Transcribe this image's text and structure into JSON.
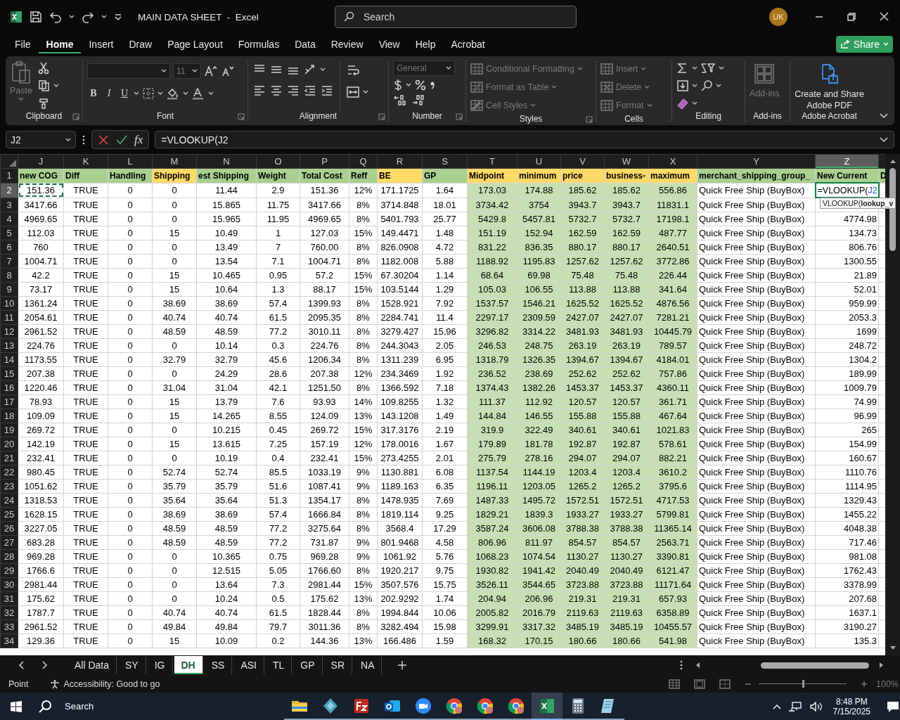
{
  "title_bar": {
    "title": "MAIN DATA SHEET  -  Excel",
    "search": {
      "placeholder": "Search"
    },
    "avatar": "UK"
  },
  "menu_tabs": [
    {
      "label": "File",
      "selected": false
    },
    {
      "label": "Home",
      "selected": true
    },
    {
      "label": "Insert",
      "selected": false
    },
    {
      "label": "Draw",
      "selected": false
    },
    {
      "label": "Page Layout",
      "selected": false
    },
    {
      "label": "Formulas",
      "selected": false
    },
    {
      "label": "Data",
      "selected": false
    },
    {
      "label": "Review",
      "selected": false
    },
    {
      "label": "View",
      "selected": false
    },
    {
      "label": "Help",
      "selected": false
    },
    {
      "label": "Acrobat",
      "selected": false
    }
  ],
  "share_button": "Share",
  "ribbon": {
    "clipboard": {
      "label": "Clipboard",
      "paste": {
        "label": "Paste",
        "disabled": true
      }
    },
    "font": {
      "label": "Font",
      "points": "11",
      "styles": [
        "B",
        "I",
        "U"
      ]
    },
    "alignment": {
      "label": "Alignment"
    },
    "number": {
      "label": "Number",
      "format": "General"
    },
    "styles": {
      "label": "Styles",
      "items": [
        {
          "label": "Conditional Formatting",
          "disabled": true
        },
        {
          "label": "Format as Table",
          "disabled": true
        },
        {
          "label": "Cell Styles",
          "disabled": true
        }
      ]
    },
    "cells": {
      "label": "Cells",
      "items": [
        {
          "label": "Insert",
          "disabled": true
        },
        {
          "label": "Delete",
          "disabled": true
        },
        {
          "label": "Format",
          "disabled": true
        }
      ]
    },
    "editing": {
      "label": "Editing"
    },
    "addins": {
      "label": "Add-ins",
      "button": {
        "label": "Add-ins",
        "disabled": true
      }
    },
    "acrobat": {
      "label": "Adobe Acrobat",
      "button": {
        "label": "Create and Share Adobe PDF",
        "disabled": false
      }
    }
  },
  "formula_bar": {
    "name_box": "J2",
    "fx": "fx",
    "formula": "=VLOOKUP(J2"
  },
  "sheet": {
    "header_row_number": "1",
    "columns": [
      {
        "letter": "J",
        "label": "new COG",
        "color": "#a9d08e",
        "kind": "number",
        "shaded": false,
        "selected": false
      },
      {
        "letter": "K",
        "label": "Diff",
        "color": "#a9d08e",
        "kind": "number",
        "shaded": false,
        "selected": false
      },
      {
        "letter": "L",
        "label": "Handling",
        "color": "#a9d08e",
        "kind": "number",
        "shaded": false,
        "selected": false
      },
      {
        "letter": "M",
        "label": "Shipping",
        "color": "#ffd966",
        "kind": "number",
        "shaded": false,
        "selected": false
      },
      {
        "letter": "N",
        "label": "est Shipping",
        "color": "#a9d08e",
        "kind": "number",
        "shaded": false,
        "selected": false
      },
      {
        "letter": "O",
        "label": "Weight",
        "color": "#a9d08e",
        "kind": "number",
        "shaded": false,
        "selected": false
      },
      {
        "letter": "P",
        "label": "Total Cost",
        "color": "#a9d08e",
        "kind": "number",
        "shaded": false,
        "selected": false
      },
      {
        "letter": "Q",
        "label": "Reff",
        "color": "#a9d08e",
        "kind": "number",
        "shaded": false,
        "selected": false
      },
      {
        "letter": "R",
        "label": "BE",
        "color": "#ffd966",
        "kind": "number",
        "shaded": false,
        "selected": false
      },
      {
        "letter": "S",
        "label": "GP",
        "color": "#a9d08e",
        "kind": "number",
        "shaded": false,
        "selected": false
      },
      {
        "letter": "T",
        "label": "Midpoint",
        "color": "#ffd966",
        "kind": "number",
        "shaded": true,
        "selected": false
      },
      {
        "letter": "U",
        "label": "minimum",
        "color": "#ffd966",
        "kind": "number",
        "shaded": true,
        "selected": false
      },
      {
        "letter": "V",
        "label": "price",
        "color": "#ffd966",
        "kind": "number",
        "shaded": true,
        "selected": false
      },
      {
        "letter": "W",
        "label": "business-",
        "color": "#ffd966",
        "kind": "number",
        "shaded": true,
        "selected": false
      },
      {
        "letter": "X",
        "label": "maximum",
        "color": "#ffd966",
        "kind": "number",
        "shaded": true,
        "selected": false
      },
      {
        "letter": "Y",
        "label": "merchant_shipping_group_",
        "color": "#a9d08e",
        "kind": "text",
        "shaded": false,
        "selected": false
      },
      {
        "letter": "Z",
        "label": "New Current",
        "color": "#a9d08e",
        "kind": "amount",
        "shaded": false,
        "selected": true
      },
      {
        "label": "D",
        "color": "#a9d08e",
        "kind": "text",
        "shaded": false,
        "selected": false
      }
    ],
    "rows": [
      {
        "number": "2",
        "selected": true,
        "marked": true,
        "cells": [
          "151.36",
          "TRUE",
          "0",
          "0",
          "11.44",
          "2.9",
          "151.36",
          "12%",
          "171.1725",
          "1.64",
          "173.03",
          "174.88",
          "185.62",
          "185.62",
          "556.86",
          "Quick Free Ship (BuyBox)"
        ],
        "editing": {
          "prefix": "=VLOOKUP(",
          "reference": "J2"
        }
      },
      {
        "number": "3",
        "selected": false,
        "marked": false,
        "cells": [
          "3417.66",
          "TRUE",
          "0",
          "0",
          "15.865",
          "11.75",
          "3417.66",
          "8%",
          "3714.848",
          "18.01",
          "3734.42",
          "3754",
          "3943.7",
          "3943.7",
          "11831.1",
          "Quick Free Ship (BuyBox)"
        ]
      },
      {
        "number": "4",
        "selected": false,
        "marked": false,
        "cells": [
          "4969.65",
          "TRUE",
          "0",
          "0",
          "15.965",
          "11.95",
          "4969.65",
          "8%",
          "5401.793",
          "25.77",
          "5429.8",
          "5457.81",
          "5732.7",
          "5732.7",
          "17198.1",
          "Quick Free Ship (BuyBox)",
          "4774.98"
        ]
      },
      {
        "number": "5",
        "selected": false,
        "marked": false,
        "cells": [
          "112.03",
          "TRUE",
          "0",
          "15",
          "10.49",
          "1",
          "127.03",
          "15%",
          "149.4471",
          "1.48",
          "151.19",
          "152.94",
          "162.59",
          "162.59",
          "487.77",
          "Quick Free Ship (BuyBox)",
          "134.73"
        ]
      },
      {
        "number": "6",
        "selected": false,
        "marked": false,
        "cells": [
          "760",
          "TRUE",
          "0",
          "0",
          "13.49",
          "7",
          "760.00",
          "8%",
          "826.0908",
          "4.72",
          "831.22",
          "836.35",
          "880.17",
          "880.17",
          "2640.51",
          "Quick Free Ship (BuyBox)",
          "806.76"
        ]
      },
      {
        "number": "7",
        "selected": false,
        "marked": false,
        "cells": [
          "1004.71",
          "TRUE",
          "0",
          "0",
          "13.54",
          "7.1",
          "1004.71",
          "8%",
          "1182.008",
          "5.88",
          "1188.92",
          "1195.83",
          "1257.62",
          "1257.62",
          "3772.86",
          "Quick Free Ship (BuyBox)",
          "1300.55"
        ]
      },
      {
        "number": "8",
        "selected": false,
        "marked": false,
        "cells": [
          "42.2",
          "TRUE",
          "0",
          "15",
          "10.465",
          "0.95",
          "57.2",
          "15%",
          "67.30204",
          "1.14",
          "68.64",
          "69.98",
          "75.48",
          "75.48",
          "226.44",
          "Quick Free Ship (BuyBox)",
          "21.89"
        ]
      },
      {
        "number": "9",
        "selected": false,
        "marked": false,
        "cells": [
          "73.17",
          "TRUE",
          "0",
          "15",
          "10.64",
          "1.3",
          "88.17",
          "15%",
          "103.5144",
          "1.29",
          "105.03",
          "106.55",
          "113.88",
          "113.88",
          "341.64",
          "Quick Free Ship (BuyBox)",
          "52.01"
        ]
      },
      {
        "number": "10",
        "selected": false,
        "marked": false,
        "cells": [
          "1361.24",
          "TRUE",
          "0",
          "38.69",
          "38.69",
          "57.4",
          "1399.93",
          "8%",
          "1528.921",
          "7.92",
          "1537.57",
          "1546.21",
          "1625.52",
          "1625.52",
          "4876.56",
          "Quick Free Ship (BuyBox)",
          "959.99"
        ]
      },
      {
        "number": "11",
        "selected": false,
        "marked": false,
        "cells": [
          "2054.61",
          "TRUE",
          "0",
          "40.74",
          "40.74",
          "61.5",
          "2095.35",
          "8%",
          "2284.741",
          "11.4",
          "2297.17",
          "2309.59",
          "2427.07",
          "2427.07",
          "7281.21",
          "Quick Free Ship (BuyBox)",
          "2053.3"
        ]
      },
      {
        "number": "12",
        "selected": false,
        "marked": false,
        "cells": [
          "2961.52",
          "TRUE",
          "0",
          "48.59",
          "48.59",
          "77.2",
          "3010.11",
          "8%",
          "3279.427",
          "15.96",
          "3296.82",
          "3314.22",
          "3481.93",
          "3481.93",
          "10445.79",
          "Quick Free Ship (BuyBox)",
          "1699"
        ]
      },
      {
        "number": "13",
        "selected": false,
        "marked": false,
        "cells": [
          "224.76",
          "TRUE",
          "0",
          "0",
          "10.14",
          "0.3",
          "224.76",
          "8%",
          "244.3043",
          "2.05",
          "246.53",
          "248.75",
          "263.19",
          "263.19",
          "789.57",
          "Quick Free Ship (BuyBox)",
          "248.72"
        ]
      },
      {
        "number": "14",
        "selected": false,
        "marked": false,
        "cells": [
          "1173.55",
          "TRUE",
          "0",
          "32.79",
          "32.79",
          "45.6",
          "1206.34",
          "8%",
          "1311.239",
          "6.95",
          "1318.79",
          "1326.35",
          "1394.67",
          "1394.67",
          "4184.01",
          "Quick Free Ship (BuyBox)",
          "1304.2"
        ]
      },
      {
        "number": "15",
        "selected": false,
        "marked": false,
        "cells": [
          "207.38",
          "TRUE",
          "0",
          "0",
          "24.29",
          "28.6",
          "207.38",
          "12%",
          "234.3469",
          "1.92",
          "236.52",
          "238.69",
          "252.62",
          "252.62",
          "757.86",
          "Quick Free Ship (BuyBox)",
          "189.99"
        ]
      },
      {
        "number": "16",
        "selected": false,
        "marked": false,
        "cells": [
          "1220.46",
          "TRUE",
          "0",
          "31.04",
          "31.04",
          "42.1",
          "1251.50",
          "8%",
          "1366.592",
          "7.18",
          "1374.43",
          "1382.26",
          "1453.37",
          "1453.37",
          "4360.11",
          "Quick Free Ship (BuyBox)",
          "1009.79"
        ]
      },
      {
        "number": "17",
        "selected": false,
        "marked": false,
        "cells": [
          "78.93",
          "TRUE",
          "0",
          "15",
          "13.79",
          "7.6",
          "93.93",
          "14%",
          "109.8255",
          "1.32",
          "111.37",
          "112.92",
          "120.57",
          "120.57",
          "361.71",
          "Quick Free Ship (BuyBox)",
          "74.99"
        ]
      },
      {
        "number": "18",
        "selected": false,
        "marked": false,
        "cells": [
          "109.09",
          "TRUE",
          "0",
          "15",
          "14.265",
          "8.55",
          "124.09",
          "13%",
          "143.1208",
          "1.49",
          "144.84",
          "146.55",
          "155.88",
          "155.88",
          "467.64",
          "Quick Free Ship (BuyBox)",
          "96.99"
        ]
      },
      {
        "number": "19",
        "selected": false,
        "marked": false,
        "cells": [
          "269.72",
          "TRUE",
          "0",
          "0",
          "10.215",
          "0.45",
          "269.72",
          "15%",
          "317.3176",
          "2.19",
          "319.9",
          "322.49",
          "340.61",
          "340.61",
          "1021.83",
          "Quick Free Ship (BuyBox)",
          "265"
        ]
      },
      {
        "number": "20",
        "selected": false,
        "marked": false,
        "cells": [
          "142.19",
          "TRUE",
          "0",
          "15",
          "13.615",
          "7.25",
          "157.19",
          "12%",
          "178.0016",
          "1.67",
          "179.89",
          "181.78",
          "192.87",
          "192.87",
          "578.61",
          "Quick Free Ship (BuyBox)",
          "154.99"
        ]
      },
      {
        "number": "21",
        "selected": false,
        "marked": false,
        "cells": [
          "232.41",
          "TRUE",
          "0",
          "0",
          "10.19",
          "0.4",
          "232.41",
          "15%",
          "273.4255",
          "2.01",
          "275.79",
          "278.16",
          "294.07",
          "294.07",
          "882.21",
          "Quick Free Ship (BuyBox)",
          "160.67"
        ]
      },
      {
        "number": "22",
        "selected": false,
        "marked": false,
        "cells": [
          "980.45",
          "TRUE",
          "0",
          "52.74",
          "52.74",
          "85.5",
          "1033.19",
          "9%",
          "1130.881",
          "6.08",
          "1137.54",
          "1144.19",
          "1203.4",
          "1203.4",
          "3610.2",
          "Quick Free Ship (BuyBox)",
          "1110.76"
        ]
      },
      {
        "number": "23",
        "selected": false,
        "marked": false,
        "cells": [
          "1051.62",
          "TRUE",
          "0",
          "35.79",
          "35.79",
          "51.6",
          "1087.41",
          "9%",
          "1189.163",
          "6.35",
          "1196.11",
          "1203.05",
          "1265.2",
          "1265.2",
          "3795.6",
          "Quick Free Ship (BuyBox)",
          "1114.95"
        ]
      },
      {
        "number": "24",
        "selected": false,
        "marked": false,
        "cells": [
          "1318.53",
          "TRUE",
          "0",
          "35.64",
          "35.64",
          "51.3",
          "1354.17",
          "8%",
          "1478.935",
          "7.69",
          "1487.33",
          "1495.72",
          "1572.51",
          "1572.51",
          "4717.53",
          "Quick Free Ship (BuyBox)",
          "1329.43"
        ]
      },
      {
        "number": "25",
        "selected": false,
        "marked": false,
        "cells": [
          "1628.15",
          "TRUE",
          "0",
          "38.69",
          "38.69",
          "57.4",
          "1666.84",
          "8%",
          "1819.114",
          "9.25",
          "1829.21",
          "1839.3",
          "1933.27",
          "1933.27",
          "5799.81",
          "Quick Free Ship (BuyBox)",
          "1455.22"
        ]
      },
      {
        "number": "26",
        "selected": false,
        "marked": false,
        "cells": [
          "3227.05",
          "TRUE",
          "0",
          "48.59",
          "48.59",
          "77.2",
          "3275.64",
          "8%",
          "3568.4",
          "17.29",
          "3587.24",
          "3606.08",
          "3788.38",
          "3788.38",
          "11365.14",
          "Quick Free Ship (BuyBox)",
          "4048.38"
        ]
      },
      {
        "number": "27",
        "selected": false,
        "marked": false,
        "cells": [
          "683.28",
          "TRUE",
          "0",
          "48.59",
          "48.59",
          "77.2",
          "731.87",
          "9%",
          "801.9468",
          "4.58",
          "806.96",
          "811.97",
          "854.57",
          "854.57",
          "2563.71",
          "Quick Free Ship (BuyBox)",
          "717.46"
        ]
      },
      {
        "number": "28",
        "selected": false,
        "marked": false,
        "cells": [
          "969.28",
          "TRUE",
          "0",
          "0",
          "10.365",
          "0.75",
          "969.28",
          "9%",
          "1061.92",
          "5.76",
          "1068.23",
          "1074.54",
          "1130.27",
          "1130.27",
          "3390.81",
          "Quick Free Ship (BuyBox)",
          "981.08"
        ]
      },
      {
        "number": "29",
        "selected": false,
        "marked": false,
        "cells": [
          "1766.6",
          "TRUE",
          "0",
          "0",
          "12.515",
          "5.05",
          "1766.60",
          "8%",
          "1920.217",
          "9.75",
          "1930.82",
          "1941.42",
          "2040.49",
          "2040.49",
          "6121.47",
          "Quick Free Ship (BuyBox)",
          "1762.43"
        ]
      },
      {
        "number": "30",
        "selected": false,
        "marked": false,
        "cells": [
          "2981.44",
          "TRUE",
          "0",
          "0",
          "13.64",
          "7.3",
          "2981.44",
          "15%",
          "3507.576",
          "15.75",
          "3526.11",
          "3544.65",
          "3723.88",
          "3723.88",
          "11171.64",
          "Quick Free Ship (BuyBox)",
          "3378.99"
        ]
      },
      {
        "number": "31",
        "selected": false,
        "marked": false,
        "cells": [
          "175.62",
          "TRUE",
          "0",
          "0",
          "10.24",
          "0.5",
          "175.62",
          "13%",
          "202.9292",
          "1.74",
          "204.94",
          "206.96",
          "219.31",
          "219.31",
          "657.93",
          "Quick Free Ship (BuyBox)",
          "207.68"
        ]
      },
      {
        "number": "32",
        "selected": false,
        "marked": false,
        "cells": [
          "1787.7",
          "TRUE",
          "0",
          "40.74",
          "40.74",
          "61.5",
          "1828.44",
          "8%",
          "1994.844",
          "10.06",
          "2005.82",
          "2016.79",
          "2119.63",
          "2119.63",
          "6358.89",
          "Quick Free Ship (BuyBox)",
          "1637.1"
        ]
      },
      {
        "number": "33",
        "selected": false,
        "marked": false,
        "cells": [
          "2961.52",
          "TRUE",
          "0",
          "49.84",
          "49.84",
          "79.7",
          "3011.36",
          "8%",
          "3282.494",
          "15.98",
          "3299.91",
          "3317.32",
          "3485.19",
          "3485.19",
          "10455.57",
          "Quick Free Ship (BuyBox)",
          "3190.27"
        ]
      },
      {
        "number": "34",
        "selected": false,
        "marked": false,
        "cells": [
          "129.36",
          "TRUE",
          "0",
          "15",
          "10.09",
          "0.2",
          "144.36",
          "13%",
          "166.486",
          "1.59",
          "168.32",
          "170.15",
          "180.66",
          "180.66",
          "541.98",
          "Quick Free Ship (BuyBox)",
          "135.3"
        ]
      }
    ],
    "tooltip": "VLOOKUP(**lookup_v**"
  },
  "sheet_tabs": [
    {
      "label": "All Data",
      "selected": false
    },
    {
      "label": "SY",
      "selected": false
    },
    {
      "label": "IG",
      "selected": false
    },
    {
      "label": "DH",
      "selected": true
    },
    {
      "label": "SS",
      "selected": false
    },
    {
      "label": "ASI",
      "selected": false
    },
    {
      "label": "TL",
      "selected": false
    },
    {
      "label": "GP",
      "selected": false
    },
    {
      "label": "SR",
      "selected": false
    },
    {
      "label": "NA",
      "selected": false
    }
  ],
  "status_bar": {
    "mode": "Point",
    "accessibility": "Accessibility: Good to go",
    "zoom": {
      "label": "100%",
      "level": 0.5
    }
  },
  "taskbar": {
    "search": "Search",
    "apps": [
      {
        "kind": "folder",
        "active": false
      },
      {
        "kind": "diamond",
        "active": false
      },
      {
        "kind": "transfer",
        "active": false
      },
      {
        "kind": "mail",
        "active": false
      },
      {
        "kind": "video",
        "active": false
      },
      {
        "kind": "browser",
        "active": false
      },
      {
        "kind": "browser",
        "active": false
      },
      {
        "kind": "browser",
        "active": false
      },
      {
        "kind": "sheet",
        "active": true
      },
      {
        "kind": "calculator",
        "active": false
      },
      {
        "kind": "notes",
        "active": false
      }
    ],
    "time": "8:48 PM",
    "date": "7/15/2025"
  }
}
